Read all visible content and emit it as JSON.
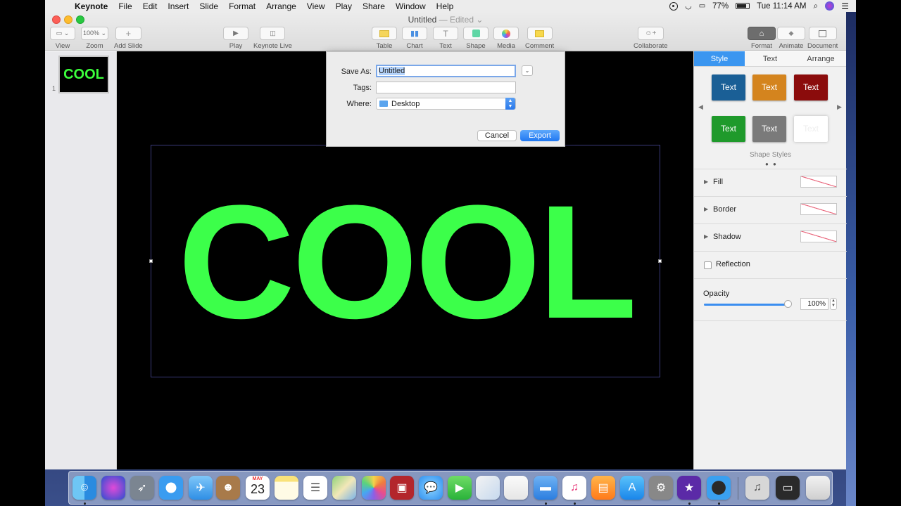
{
  "menubar": {
    "app_name": "Keynote",
    "items": [
      "File",
      "Edit",
      "Insert",
      "Slide",
      "Format",
      "Arrange",
      "View",
      "Play",
      "Share",
      "Window",
      "Help"
    ],
    "battery": "77%",
    "clock": "Tue 11:14 AM"
  },
  "window": {
    "title": "Untitled",
    "title_status": " — Edited ⌄"
  },
  "toolbar": {
    "view_label": "View",
    "zoom_value": "100% ⌄",
    "zoom_label": "Zoom",
    "add_slide_label": "Add Slide",
    "play_label": "Play",
    "keynote_live_label": "Keynote Live",
    "table_label": "Table",
    "chart_label": "Chart",
    "text_label": "Text",
    "shape_label": "Shape",
    "media_label": "Media",
    "comment_label": "Comment",
    "collaborate_label": "Collaborate",
    "format_label": "Format",
    "animate_label": "Animate",
    "document_label": "Document"
  },
  "navigator": {
    "slide_number": "1",
    "thumb_text": "COOL"
  },
  "slide": {
    "text": "COOL",
    "text_color": "#3cff4a"
  },
  "dialog": {
    "save_as_label": "Save As:",
    "save_as_value": "Untitled",
    "tags_label": "Tags:",
    "where_label": "Where:",
    "where_value": "Desktop",
    "cancel_label": "Cancel",
    "export_label": "Export"
  },
  "inspector": {
    "tabs": [
      "Style",
      "Text",
      "Arrange"
    ],
    "style_swatches": [
      {
        "label": "Text",
        "color": "#1a5f96"
      },
      {
        "label": "Text",
        "color": "#d4841e"
      },
      {
        "label": "Text",
        "color": "#8b0c0c"
      },
      {
        "label": "Text",
        "color": "#1f9a2b"
      },
      {
        "label": "Text",
        "color": "#7a7a7a"
      },
      {
        "label": "Text",
        "color": "#ffffff"
      }
    ],
    "shape_styles_label": "Shape Styles",
    "fill_label": "Fill",
    "border_label": "Border",
    "shadow_label": "Shadow",
    "reflection_label": "Reflection",
    "opacity_label": "Opacity",
    "opacity_value": "100%",
    "opacity_level": 1.0
  },
  "dock": {
    "icons": [
      "finder-icon",
      "siri-icon",
      "launchpad-icon",
      "safari-icon",
      "mail-icon",
      "contacts-icon",
      "calendar-icon",
      "notes-icon",
      "reminders-icon",
      "maps-icon",
      "photos-icon",
      "photo-booth-icon",
      "messages-icon",
      "facetime-icon",
      "preview-icon",
      "numbers-icon",
      "keynote-icon",
      "itunes-icon",
      "ibooks-icon",
      "app-store-icon",
      "system-preferences-icon",
      "imovie-icon",
      "quicktime-icon",
      "music-folder-icon",
      "screen-recorder-icon",
      "trash-icon"
    ],
    "calendar_month": "MAY",
    "calendar_day": "23"
  }
}
